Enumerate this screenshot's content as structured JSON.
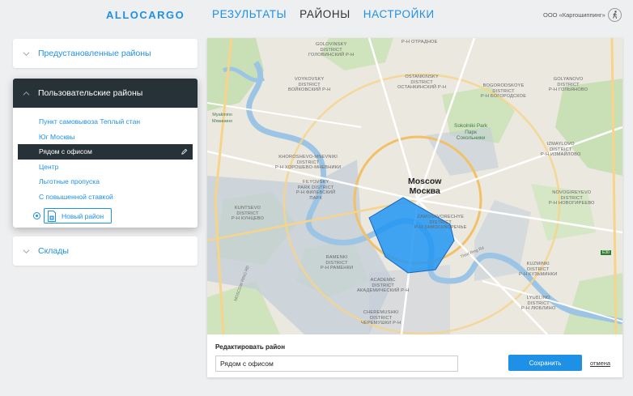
{
  "header": {
    "logo": "ALLOCARGO",
    "nav": [
      {
        "label": "РЕЗУЛЬТАТЫ",
        "active": false
      },
      {
        "label": "РАЙОНЫ",
        "active": true
      },
      {
        "label": "НАСТРОЙКИ",
        "active": false
      }
    ],
    "company": "ООО «Каргошиппинг»",
    "user_icon": "walking-person-icon"
  },
  "sidebar": {
    "preset": {
      "title": "Предустановленные районы",
      "icon": "chevron-down-icon"
    },
    "custom": {
      "title": "Пользовательские районы",
      "icon": "chevron-up-icon",
      "items": [
        {
          "label": "Пункт самовывоза Теплый стан",
          "selected": false
        },
        {
          "label": "Юг Москвы",
          "selected": false
        },
        {
          "label": "Рядом с офисом",
          "selected": true
        },
        {
          "label": "Центр",
          "selected": false
        },
        {
          "label": "Льготные пропуска",
          "selected": false
        },
        {
          "label": "С повышенной ставкой",
          "selected": false
        }
      ],
      "edit_icon": "pencil-icon",
      "new_button": "Новый район"
    },
    "warehouses": {
      "title": "Склады",
      "icon": "chevron-down-icon"
    }
  },
  "map": {
    "city": [
      "Moscow",
      "Москва"
    ],
    "labels": [
      [
        "GOLOVINSKY",
        "DISTRICT",
        "ГОЛОВИНСКИЙ Р-Н"
      ],
      [
        "VOYKOVSKY",
        "DISTRICT",
        "ВОЙКОВСКИЙ Р-Н"
      ],
      [
        "OSTANKINSKY",
        "DISTRICT",
        "ОСТАНКИНСКИЙ Р-Н"
      ],
      [
        "GOLYANOVO",
        "DISTRICT",
        "Р-Н ГОЛЬЯНОВО"
      ],
      [
        "BOGORODSKOYE",
        "DISTRICT",
        "Р-Н БОГОРОДСКОЕ"
      ],
      [
        "IZMAYLOVO",
        "DISTRICT",
        "Р-Н ИЗМАЙЛОВО"
      ],
      [
        "NOVOGIREYEVO",
        "DISTRICT",
        "Р-Н НОВОГИРЕЕВО"
      ],
      [
        "KHOROSHEVO-MNEVNIKI",
        "DISTRICT",
        "Р-Н ХОРОШЕВО-МНЕВНИКИ"
      ],
      [
        "FILYOVSKY",
        "PARK DISTRICT",
        "Р-Н ФИЛЕВСКИЙ",
        "ПАРК"
      ],
      [
        "KUNTSEVO",
        "DISTRICT",
        "Р-Н КУНЦЕВО"
      ],
      [
        "ZAMOSKVORECHYE",
        "DISTRICT",
        "Р-Н ЗАМОСКВОРЕЧЬЕ"
      ],
      [
        "RAMENKI",
        "DISTRICT",
        "Р-Н РАМЕНКИ"
      ],
      [
        "ACADEMIC",
        "DISTRICT",
        "АКАДЕМИЧЕСКИЙ Р-Н"
      ],
      [
        "CHEREMUSHKI",
        "DISTRICT",
        "ЧЕРЕМУШКИ Р-Н"
      ],
      [
        "KUZMINKI",
        "DISTRICT",
        "Р-Н КУЗЬМИНКИ"
      ],
      [
        "LYUBLINO",
        "DISTRICT",
        "Р-Н ЛЮБЛИНО"
      ],
      [
        "Р-Н ОТРАДНОЕ"
      ]
    ],
    "parks": [
      [
        "Sokolniki Park",
        "Парк",
        "Сокольники"
      ],
      [
        "Myakinino",
        "Мякинино"
      ]
    ],
    "roads": [
      "Third Ring Rd",
      "MOSCOW RING RD",
      "E30"
    ],
    "polygon_color": "#2196f3",
    "ring_color": "#f5c56b"
  },
  "edit": {
    "title": "Редактировать район",
    "value": "Рядом с офисом",
    "save": "Сохранить",
    "cancel": "отмена"
  }
}
